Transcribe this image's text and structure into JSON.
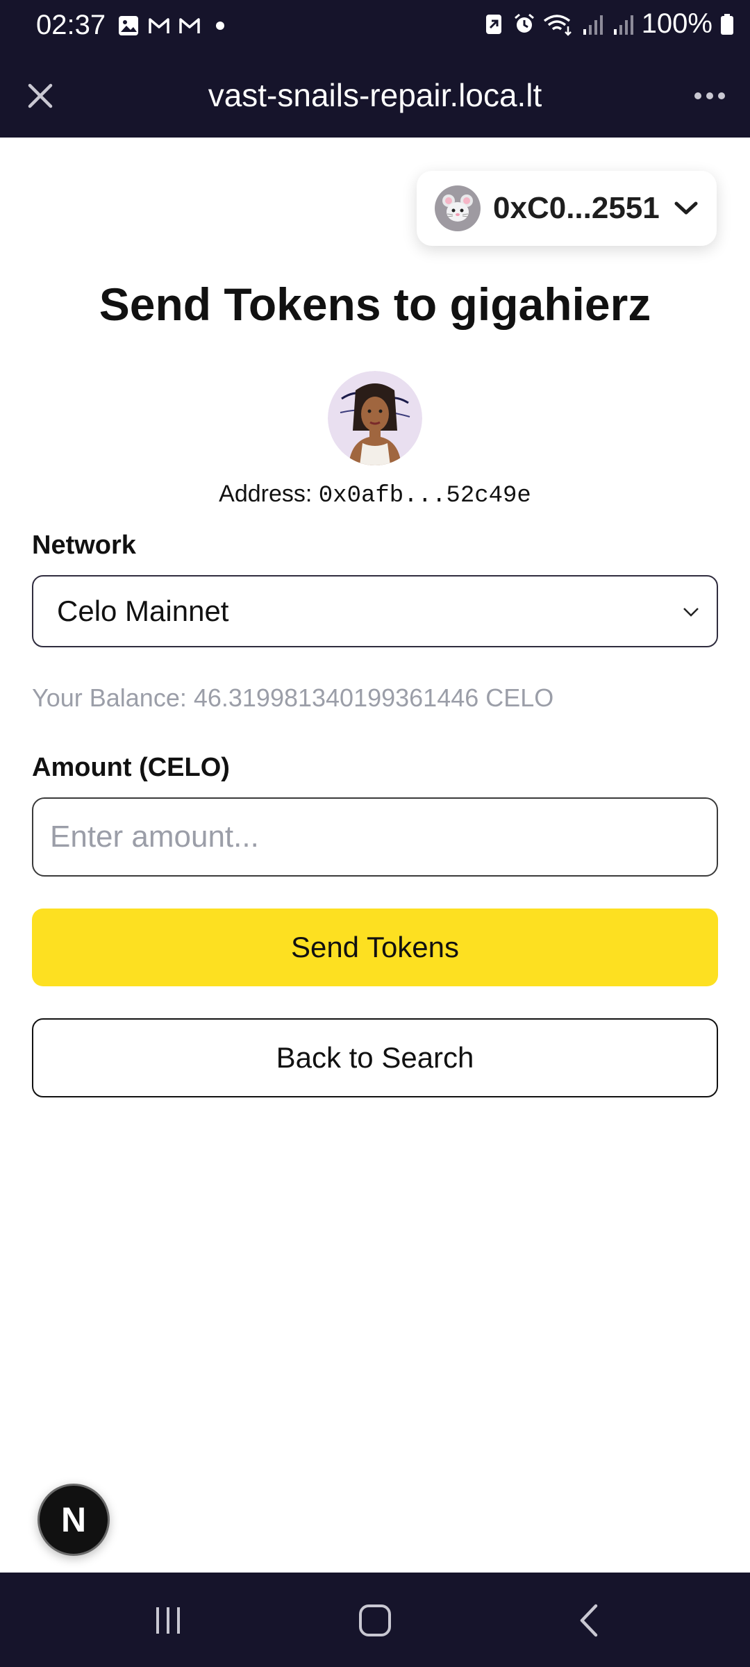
{
  "status_bar": {
    "time": "02:37",
    "battery": "100%",
    "icons": [
      "image-icon",
      "gmail-icon",
      "gmail-icon",
      "dot-icon",
      "nfc-icon",
      "alarm-icon",
      "wifi-icon",
      "signal-icon",
      "signal-icon",
      "battery-icon"
    ]
  },
  "browser": {
    "url": "vast-snails-repair.loca.lt"
  },
  "wallet": {
    "address": "0xC0...2551"
  },
  "page": {
    "title": "Send Tokens to gigahierz",
    "address_label": "Address: ",
    "address_value": "0x0afb...52c49e"
  },
  "form": {
    "network_label": "Network",
    "network_value": "Celo Mainnet",
    "balance": "Your Balance: 46.319981340199361446 CELO",
    "amount_label": "Amount (CELO)",
    "amount_placeholder": "Enter amount...",
    "amount_value": "",
    "send_button": "Send Tokens",
    "back_button": "Back to Search"
  },
  "badge": {
    "letter": "N"
  },
  "colors": {
    "bar_bg": "#16142b",
    "send_button_bg": "#fde021",
    "muted_text": "#9b9ea8"
  }
}
